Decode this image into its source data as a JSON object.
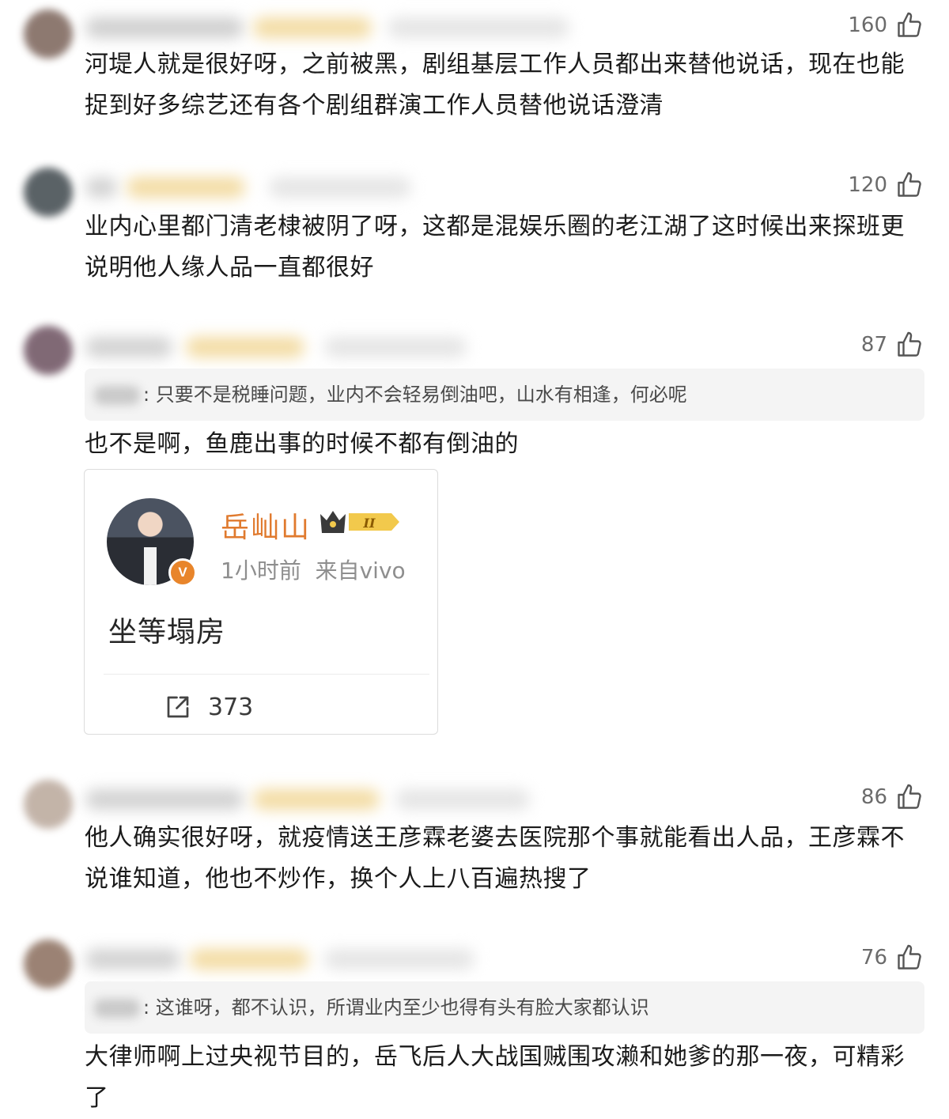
{
  "comments": [
    {
      "likes": "160",
      "text": "河堤人就是很好呀，之前被黑，剧组基层工作人员都出来替他说话，现在也能捉到好多综艺还有各个剧组群演工作人员替他说话澄清"
    },
    {
      "likes": "120",
      "text": "业内心里都门清老棣被阴了呀，这都是混娱乐圈的老江湖了这时候出来探班更说明他人缘人品一直都很好"
    },
    {
      "likes": "87",
      "quote": ": 只要不是税睡问题，业内不会轻易倒油吧，山水有相逢，何必呢",
      "text": "也不是啊，鱼鹿出事的时候不都有倒油的"
    },
    {
      "likes": "86",
      "text": "他人确实很好呀，就疫情送王彦霖老婆去医院那个事就能看出人品，王彦霖不说谁知道，他也不炒作，换个人上八百遍热搜了"
    },
    {
      "likes": "76",
      "quote": ": 这谁呀，都不认识，所谓业内至少也得有头有脸大家都认识",
      "text": "大律师啊上过央视节目的，岳飞后人大战国贼围攻濑和她爹的那一夜，可精彩了"
    }
  ],
  "embedded_post": {
    "author": "岳屾山",
    "level_badge": "II",
    "verified_badge": "V",
    "meta": "1小时前  来自vivo",
    "content": "坐等塌房",
    "share_count": "373"
  },
  "icons": {
    "like": "thumbs-up-icon",
    "share": "share-icon",
    "verified": "verified-badge-icon",
    "crown": "crown-icon"
  },
  "colors": {
    "author_name": "#e07a2e",
    "verified": "#e8852b",
    "quote_bg": "#f4f4f4"
  }
}
